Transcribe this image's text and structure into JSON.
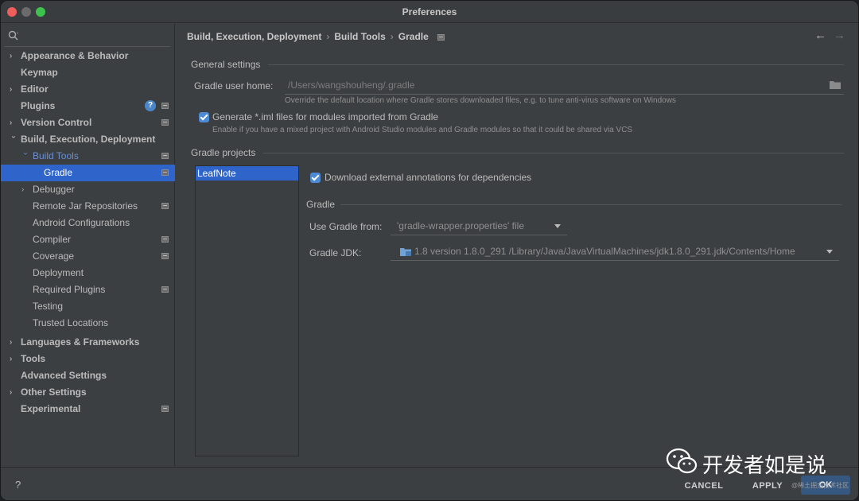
{
  "window": {
    "title": "Preferences"
  },
  "search": {
    "placeholder": "",
    "value": ""
  },
  "sidebar": {
    "items": [
      {
        "label": "Appearance & Behavior"
      },
      {
        "label": "Keymap"
      },
      {
        "label": "Editor"
      },
      {
        "label": "Plugins"
      },
      {
        "label": "Version Control"
      },
      {
        "label": "Build, Execution, Deployment"
      },
      {
        "label": "Build Tools"
      },
      {
        "label": "Gradle"
      },
      {
        "label": "Debugger"
      },
      {
        "label": "Remote Jar Repositories"
      },
      {
        "label": "Android Configurations"
      },
      {
        "label": "Compiler"
      },
      {
        "label": "Coverage"
      },
      {
        "label": "Deployment"
      },
      {
        "label": "Required Plugins"
      },
      {
        "label": "Testing"
      },
      {
        "label": "Trusted Locations"
      },
      {
        "label": "Languages & Frameworks"
      },
      {
        "label": "Tools"
      },
      {
        "label": "Advanced Settings"
      },
      {
        "label": "Other Settings"
      },
      {
        "label": "Experimental"
      }
    ],
    "plugins_badge": "?"
  },
  "breadcrumb": {
    "items": [
      "Build, Execution, Deployment",
      "Build Tools",
      "Gradle"
    ],
    "separator": "›"
  },
  "general": {
    "title": "General settings",
    "user_home_label": "Gradle user home:",
    "user_home_value": "/Users/wangshouheng/.gradle",
    "user_home_hint": "Override the default location where Gradle stores downloaded files, e.g. to tune anti-virus software on Windows",
    "generate_iml_label": "Generate *.iml files for modules imported from Gradle",
    "generate_iml_checked": true,
    "generate_iml_hint": "Enable if you have a mixed project with Android Studio modules and Gradle modules so that it could be shared via VCS"
  },
  "projects": {
    "title": "Gradle projects",
    "list": [
      "LeafNote"
    ],
    "download_annotations_label": "Download external annotations for dependencies",
    "download_annotations_checked": true,
    "gradle_section": "Gradle",
    "use_gradle_from_label": "Use Gradle from:",
    "use_gradle_from_value": "'gradle-wrapper.properties' file",
    "gradle_jdk_label": "Gradle JDK:",
    "gradle_jdk_value": "1.8 version 1.8.0_291 /Library/Java/JavaVirtualMachines/jdk1.8.0_291.jdk/Contents/Home"
  },
  "footer": {
    "help": "?",
    "cancel": "CANCEL",
    "apply": "APPLY",
    "ok": "OK"
  },
  "watermark": {
    "text": "开发者如是说",
    "small": "@稀土掘金技术社区"
  },
  "colors": {
    "selection": "#2f65ca",
    "background": "#3c3f41",
    "checkbox": "#4c8ad5",
    "ok_button": "#365880"
  }
}
